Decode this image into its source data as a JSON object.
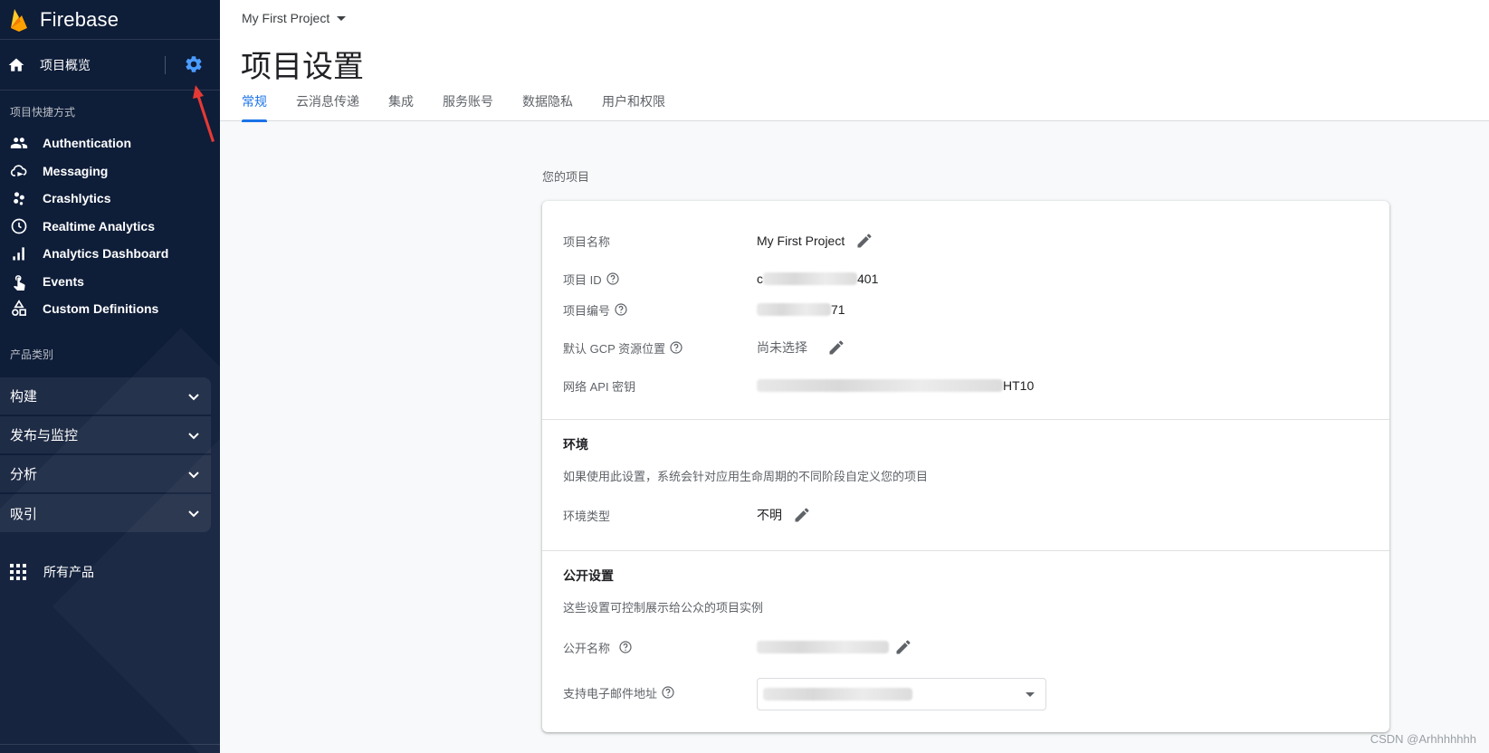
{
  "brand": {
    "name": "Firebase"
  },
  "sidebar": {
    "overview_label": "项目概览",
    "shortcuts_title": "项目快捷方式",
    "shortcuts": [
      {
        "label": "Authentication",
        "icon": "people-icon"
      },
      {
        "label": "Messaging",
        "icon": "cloud-messaging-icon"
      },
      {
        "label": "Crashlytics",
        "icon": "crashlytics-icon"
      },
      {
        "label": "Realtime Analytics",
        "icon": "clock-icon"
      },
      {
        "label": "Analytics Dashboard",
        "icon": "bar-chart-icon"
      },
      {
        "label": "Events",
        "icon": "touch-icon"
      },
      {
        "label": "Custom Definitions",
        "icon": "shapes-icon"
      }
    ],
    "categories_title": "产品类别",
    "categories": [
      {
        "label": "构建"
      },
      {
        "label": "发布与监控"
      },
      {
        "label": "分析"
      },
      {
        "label": "吸引"
      }
    ],
    "all_products_label": "所有产品"
  },
  "header": {
    "project_selector": "My First Project",
    "title": "项目设置",
    "tabs": [
      {
        "label": "常规",
        "active": true
      },
      {
        "label": "云消息传递"
      },
      {
        "label": "集成"
      },
      {
        "label": "服务账号"
      },
      {
        "label": "数据隐私"
      },
      {
        "label": "用户和权限"
      }
    ]
  },
  "content": {
    "section_label": "您的项目",
    "project": {
      "name_label": "项目名称",
      "name_value": "My First Project",
      "id_label": "项目 ID",
      "id_prefix": "c",
      "id_suffix": "401",
      "number_label": "项目编号",
      "number_suffix": "71",
      "gcp_label": "默认 GCP 资源位置",
      "gcp_value": "尚未选择",
      "apikey_label": "网络 API 密钥",
      "apikey_suffix": "HT10"
    },
    "environment": {
      "title": "环境",
      "desc": "如果使用此设置，系统会针对应用生命周期的不同阶段自定义您的项目",
      "type_label": "环境类型",
      "type_value": "不明"
    },
    "public": {
      "title": "公开设置",
      "desc": "这些设置可控制展示给公众的项目实例",
      "name_label": "公开名称",
      "email_label": "支持电子邮件地址"
    }
  },
  "watermark": "CSDN @Arhhhhhhh",
  "colors": {
    "sidebar_bg": "#0e1d38",
    "accent": "#1a73e8",
    "gear": "#4a9cff",
    "flame": "#ffa000"
  }
}
